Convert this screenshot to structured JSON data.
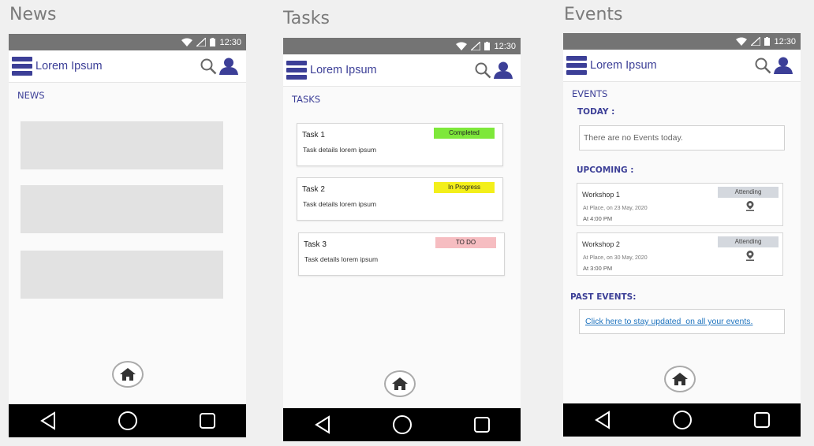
{
  "screens": {
    "news": {
      "caption": "News",
      "status_time": "12:30",
      "app_title": "Lorem Ipsum",
      "section_title": "NEWS"
    },
    "tasks": {
      "caption": "Tasks",
      "status_time": "12:30",
      "app_title": "Lorem Ipsum",
      "section_title": "TASKS",
      "items": [
        {
          "name": "Task 1",
          "details": "Task details lorem ipsum",
          "status": "Completed",
          "status_color": "#7ee83a"
        },
        {
          "name": "Task 2",
          "details": "Task details lorem ipsum",
          "status": "In Progress",
          "status_color": "#f3ef1b"
        },
        {
          "name": "Task 3",
          "details": "Task details lorem ipsum",
          "status": "TO DO",
          "status_color": "#f6bdc1"
        }
      ]
    },
    "events": {
      "caption": "Events",
      "status_time": "12:30",
      "app_title": "Lorem Ipsum",
      "section_title": "EVENTS",
      "today_label": "TODAY :",
      "today_empty": "There are no Events today.",
      "upcoming_label": "UPCOMING :",
      "upcoming": [
        {
          "name": "Workshop 1",
          "place": "At Place, on 23 May, 2020",
          "time": "At 4:00 PM",
          "status": "Attending"
        },
        {
          "name": "Workshop 2",
          "place": "At Place, on 30 May, 2020",
          "time": "At 3:00 PM",
          "status": "Attending"
        }
      ],
      "past_label": "PAST EVENTS:",
      "past_link": "Click here to stay updated  on all your events."
    }
  },
  "icons": {
    "menu": "hamburger-menu-icon",
    "search": "search-icon",
    "user": "user-icon",
    "home": "home-icon",
    "back": "back-triangle-icon",
    "nav_home": "circle-home-icon",
    "recents": "square-recents-icon",
    "location": "location-pin-icon"
  },
  "colors": {
    "accent": "#3c3f97",
    "status_bar": "#747474",
    "nav_bar": "#000000",
    "link": "#1e73be"
  }
}
